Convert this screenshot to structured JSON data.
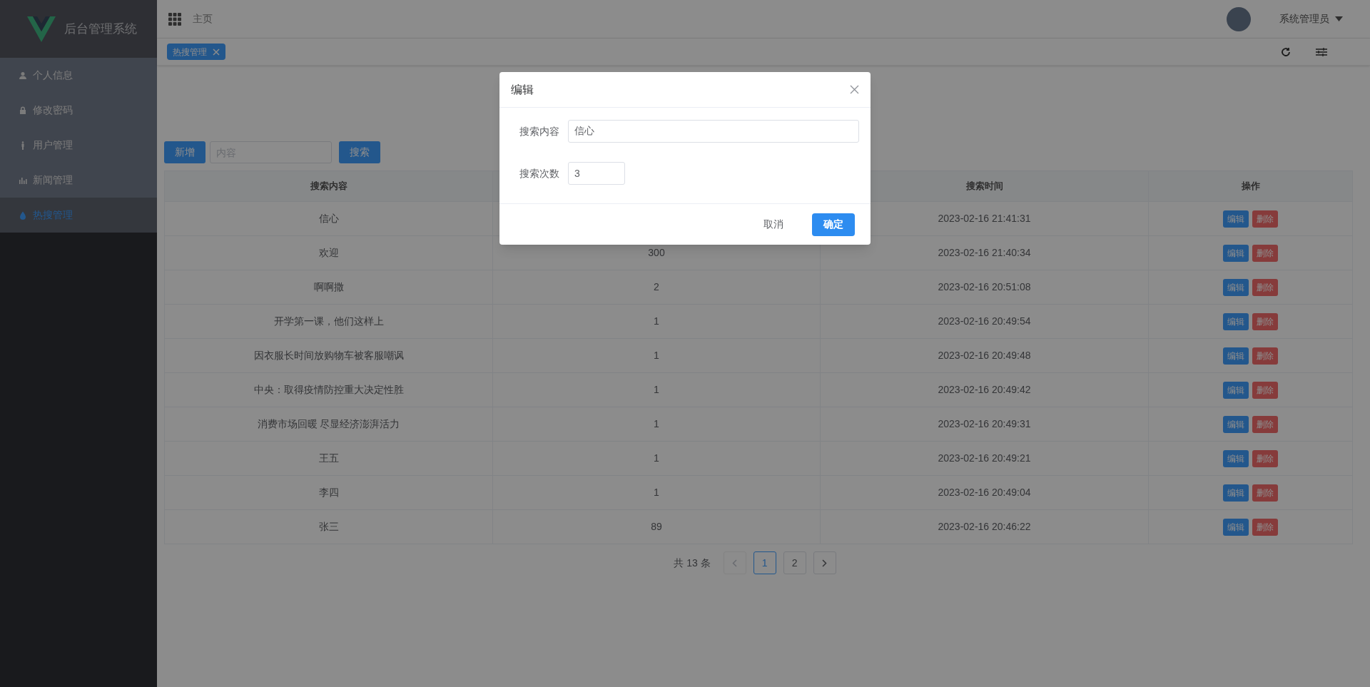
{
  "sidebar": {
    "logo_text": "后台管理系统",
    "items": [
      {
        "label": "个人信息",
        "selected": false
      },
      {
        "label": "修改密码",
        "selected": false
      },
      {
        "label": "用户管理",
        "selected": false
      },
      {
        "label": "新闻管理",
        "selected": false
      },
      {
        "label": "热搜管理",
        "selected": true
      }
    ]
  },
  "header": {
    "breadcrumb": "主页",
    "user": "系统管理员"
  },
  "tags": [
    {
      "label": "热搜管理",
      "selected": true
    }
  ],
  "toolbar": {
    "add_button": "新增",
    "search": {
      "placeholder": "内容"
    },
    "search_button": "搜索"
  },
  "table": {
    "columns": {
      "column_1": "搜索内容",
      "column_3": "搜索时间",
      "column_4": "操作"
    },
    "rows": [
      {
        "content": "信心",
        "time": "2023-02-16 21:41:31",
        "edit": "编辑",
        "delete": "删除"
      },
      {
        "content": "欢迎",
        "count": "300",
        "time": "2023-02-16 21:40:34",
        "edit": "编辑",
        "delete": "删除"
      },
      {
        "content": "啊啊撒",
        "count": "2",
        "time": "2023-02-16 20:51:08",
        "edit": "编辑",
        "delete": "删除"
      },
      {
        "content": "开学第一课，他们这样上",
        "count": "1",
        "time": "2023-02-16 20:49:54",
        "edit": "编辑",
        "delete": "删除"
      },
      {
        "content": "因衣服长时间放购物车被客服嘲讽",
        "count": "1",
        "time": "2023-02-16 20:49:48",
        "edit": "编辑",
        "delete": "删除"
      },
      {
        "content": "中央：取得疫情防控重大决定性胜",
        "count": "1",
        "time": "2023-02-16 20:49:42",
        "edit": "编辑",
        "delete": "删除"
      },
      {
        "content": "消费市场回暖 尽显经济澎湃活力",
        "count": "1",
        "time": "2023-02-16 20:49:31",
        "edit": "编辑",
        "delete": "删除"
      },
      {
        "content": "王五",
        "count": "1",
        "time": "2023-02-16 20:49:21",
        "edit": "编辑",
        "delete": "删除"
      },
      {
        "content": "李四",
        "count": "1",
        "time": "2023-02-16 20:49:04",
        "edit": "编辑",
        "delete": "删除"
      },
      {
        "content": "张三",
        "count": "89",
        "time": "2023-02-16 20:46:22",
        "edit": "编辑",
        "delete": "删除"
      }
    ]
  },
  "pagination": {
    "total": "共 13 条",
    "prev_disabled": true,
    "next_disabled": false,
    "pages": [
      {
        "label": "1",
        "selected": true
      },
      {
        "label": "2",
        "selected": false
      }
    ]
  },
  "dialog": {
    "title": "编辑",
    "fields": [
      {
        "label": "搜索内容",
        "value": "信心",
        "kind": "wide"
      },
      {
        "label": "搜索次数",
        "value": "3",
        "kind": "narrow"
      }
    ],
    "cancel": "取消",
    "confirm": "确定"
  }
}
